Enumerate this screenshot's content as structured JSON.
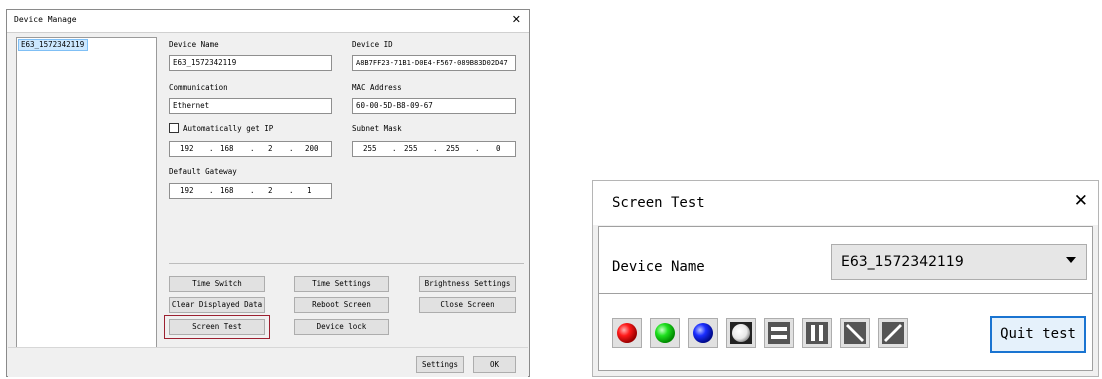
{
  "device_manage": {
    "title": "Device Manage",
    "device_list": [
      "E63_1572342119"
    ],
    "device_name_label": "Device Name",
    "device_name_value": "E63_1572342119",
    "device_id_label": "Device ID",
    "device_id_value": "A8B7FF23-71B1-D0E4-F567-089B83D02D47",
    "communication_label": "Communication",
    "communication_value": "Ethernet",
    "mac_label": "MAC Address",
    "mac_value": "60-00-5D-B8-09-67",
    "auto_ip_label": "Automatically get IP",
    "auto_ip_checked": false,
    "ip": [
      "192",
      "168",
      "2",
      "200"
    ],
    "subnet_label": "Subnet Mask",
    "subnet": [
      "255",
      "255",
      "255",
      "0"
    ],
    "gateway_label": "Default Gateway",
    "gateway": [
      "192",
      "168",
      "2",
      "1"
    ],
    "buttons": {
      "time_switch": "Time Switch",
      "time_settings": "Time Settings",
      "brightness_settings": "Brightness Settings",
      "clear_displayed_data": "Clear Displayed Data",
      "reboot_screen": "Reboot Screen",
      "close_screen": "Close Screen",
      "screen_test": "Screen Test",
      "device_lock": "Device lock",
      "settings": "Settings",
      "ok": "OK"
    }
  },
  "screen_test": {
    "title": "Screen Test",
    "device_name_label": "Device Name",
    "device_name_value": "E63_1572342119",
    "test_buttons": [
      "red-test",
      "green-test",
      "blue-test",
      "white-test",
      "horizontal-lines-test",
      "vertical-lines-test",
      "diagonal-left-test",
      "diagonal-right-test"
    ],
    "quit_label": "Quit test"
  }
}
